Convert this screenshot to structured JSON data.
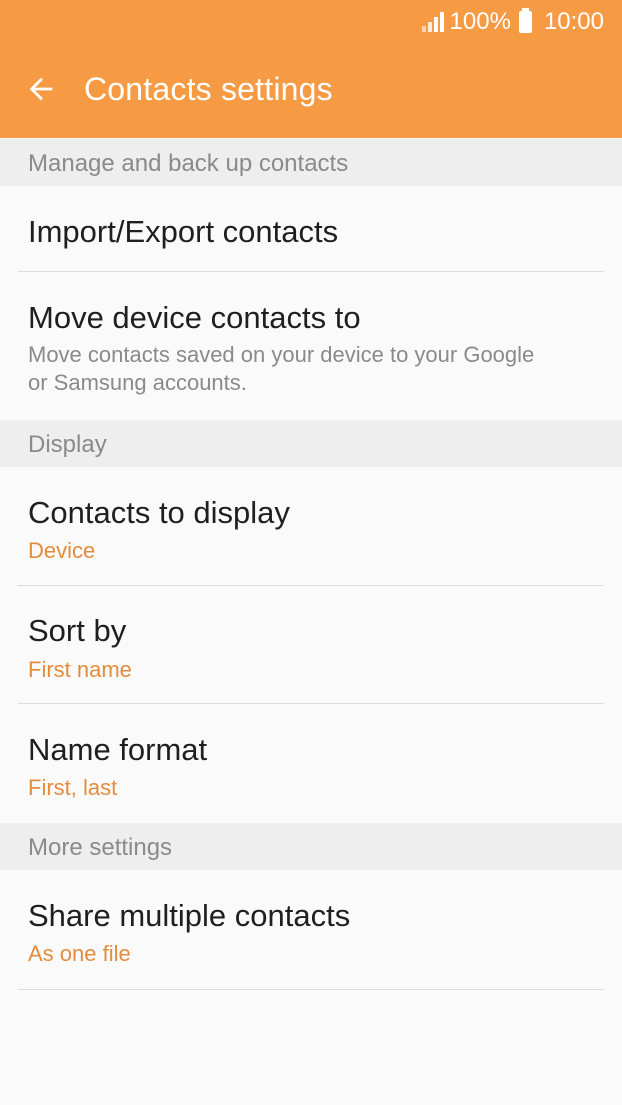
{
  "status_bar": {
    "battery": "100%",
    "time": "10:00"
  },
  "header": {
    "title": "Contacts settings"
  },
  "sections": [
    {
      "title": "Manage and back up contacts",
      "items": [
        {
          "label": "Import/Export contacts"
        },
        {
          "label": "Move device contacts to",
          "description": "Move contacts saved on your device to your Google or Samsung accounts."
        }
      ]
    },
    {
      "title": "Display",
      "items": [
        {
          "label": "Contacts to display",
          "value": "Device"
        },
        {
          "label": "Sort by",
          "value": "First name"
        },
        {
          "label": "Name format",
          "value": "First, last"
        }
      ]
    },
    {
      "title": "More settings",
      "items": [
        {
          "label": "Share multiple contacts",
          "value": "As one file"
        }
      ]
    }
  ],
  "colors": {
    "appbar": "#f79a44",
    "accent_text": "#e48c3c",
    "section_bg": "#eeeeee",
    "background": "#fafafa"
  }
}
